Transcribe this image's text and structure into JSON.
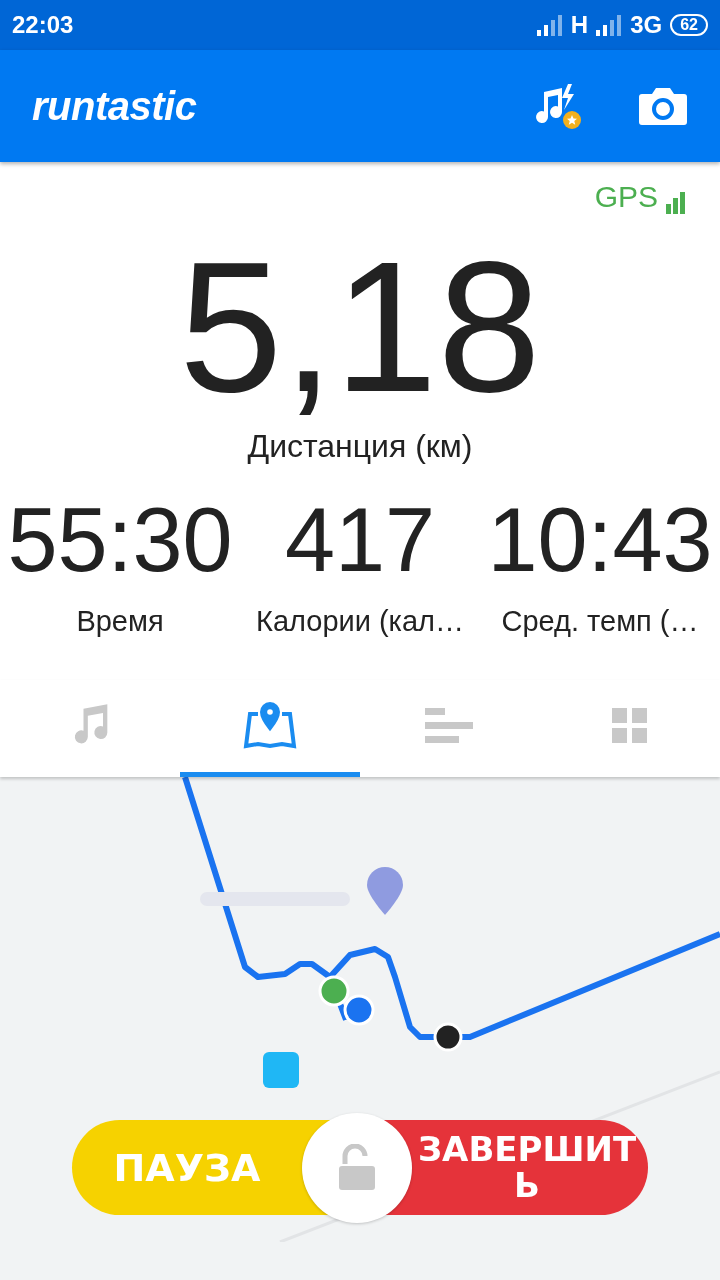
{
  "status_bar": {
    "time": "22:03",
    "network_1": "H",
    "network_2": "3G",
    "battery": "62"
  },
  "app_bar": {
    "logo": "runtastic"
  },
  "gps": {
    "label": "GPS"
  },
  "main_metric": {
    "value": "5,18",
    "label": "Дистанция (км)"
  },
  "metrics": [
    {
      "value": "55:30",
      "label": "Время"
    },
    {
      "value": "417",
      "label": "Калории (кал…"
    },
    {
      "value": "10:43",
      "label": "Сред. темп (…"
    }
  ],
  "tabs": [
    {
      "kind": "music",
      "selected": false
    },
    {
      "kind": "map",
      "selected": true
    },
    {
      "kind": "stats",
      "selected": false
    },
    {
      "kind": "grid",
      "selected": false
    }
  ],
  "controls": {
    "pause": "ПАУЗА",
    "finish": "ЗАВЕРШИТЬ"
  }
}
